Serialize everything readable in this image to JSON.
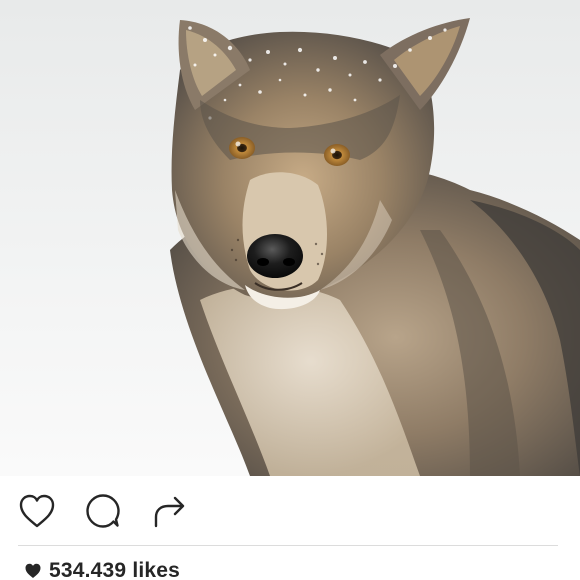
{
  "post": {
    "image": {
      "subject": "wolf",
      "background_color": "#f2f3f3"
    },
    "actions": {
      "like_icon": "heart-outline-icon",
      "comment_icon": "comment-bubble-icon",
      "share_icon": "share-arrow-icon"
    },
    "likes": {
      "icon": "heart-filled-icon",
      "label": "534.439 likes"
    }
  },
  "colors": {
    "text": "#262626",
    "icon_stroke": "#262626",
    "divider": "#dcdcdc"
  }
}
